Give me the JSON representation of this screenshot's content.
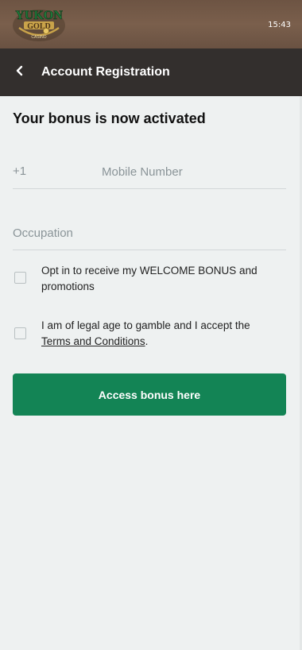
{
  "status_bar": {
    "time": "15:43",
    "logo_alt": "Yukon Gold Casino"
  },
  "header": {
    "back_icon": "chevron-left-icon",
    "title": "Account Registration"
  },
  "main": {
    "bonus_title": "Your bonus is now activated",
    "phone": {
      "prefix": "+1",
      "placeholder": "Mobile Number",
      "value": ""
    },
    "occupation": {
      "placeholder": "Occupation",
      "value": ""
    },
    "opt_in": {
      "checked": false,
      "label": "Opt in to receive my WELCOME BONUS and promotions"
    },
    "legal": {
      "checked": false,
      "label_before": "I am of legal age to gamble and I accept the ",
      "link_text": "Terms and Conditions",
      "label_after": "."
    },
    "cta_label": "Access bonus here"
  },
  "colors": {
    "topbar": "#6d5443",
    "header": "#332f2d",
    "background": "#eef1f1",
    "cta": "#138455",
    "logo_green": "#1f7a3a",
    "logo_gold": "#c9a34a"
  }
}
